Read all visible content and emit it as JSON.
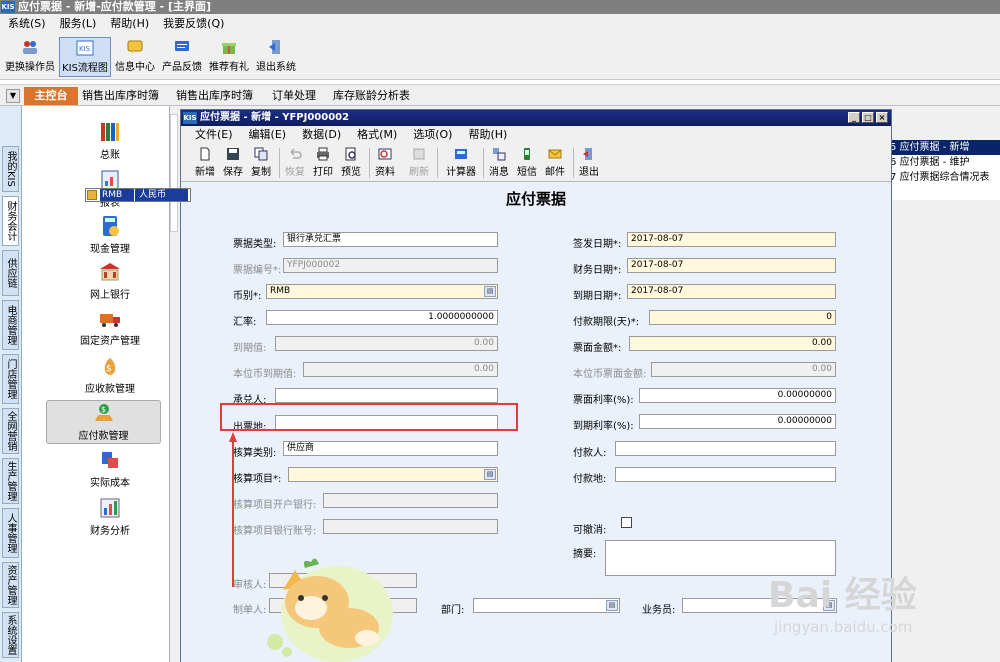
{
  "app": {
    "title": "应付票据 - 新增-应付款管理 - [主界面]",
    "logo": "KIS"
  },
  "menubar": [
    "系统(S)",
    "服务(L)",
    "帮助(H)",
    "我要反馈(Q)"
  ],
  "toolbar": {
    "items": [
      "更换操作员",
      "KIS流程图",
      "信息中心",
      "产品反馈",
      "推荐有礼",
      "退出系统"
    ]
  },
  "tabs": {
    "main": "主控台",
    "items": [
      "销售出库序时簿",
      "销售出库序时簿",
      "订单处理",
      "库存账龄分析表"
    ]
  },
  "leftbar": [
    "我的KIS",
    "财务会计",
    "供应链",
    "电商管理",
    "门店管理",
    "全网营销",
    "生产管理",
    "人事管理",
    "资产管理",
    "系统设置"
  ],
  "nav": [
    "总账",
    "报表",
    "现金管理",
    "网上银行",
    "固定资产管理",
    "应收款管理",
    "应付款管理",
    "实际成本",
    "财务分析"
  ],
  "right_list": [
    {
      "num": "5",
      "label": "应付票据 - 新增"
    },
    {
      "num": "6",
      "label": "应付票据 - 维护"
    },
    {
      "num": "7",
      "label": "应付票据综合情况表"
    }
  ],
  "child": {
    "title": "应付票据 - 新增 - YFPJ000002",
    "logo": "KIS",
    "menu": [
      "文件(E)",
      "编辑(E)",
      "数据(D)",
      "格式(M)",
      "选项(O)",
      "帮助(H)"
    ],
    "tools": [
      "新增",
      "保存",
      "复制",
      "恢复",
      "打印",
      "预览",
      "资料",
      "刷新",
      "计算器",
      "消息",
      "短信",
      "邮件",
      "退出"
    ]
  },
  "form": {
    "title": "应付票据",
    "left": [
      {
        "label": "票据类型:",
        "value": "银行承兑汇票"
      },
      {
        "label": "票据编号*:",
        "value": "YFPJ000002"
      },
      {
        "label": "币别*:",
        "value": "RMB"
      },
      {
        "label": "汇率:",
        "value": "1.0000000000"
      },
      {
        "label": "到期值:",
        "value": "0.00"
      },
      {
        "label": "本位币到期值:",
        "value": "0.00"
      },
      {
        "label": "承兑人:",
        "value": ""
      },
      {
        "label": "出票地:",
        "value": ""
      },
      {
        "label": "核算类别:",
        "value": "供应商"
      },
      {
        "label": "核算项目*:",
        "value": ""
      },
      {
        "label": "核算项目开户银行:",
        "value": ""
      },
      {
        "label": "核算项目银行账号:",
        "value": ""
      }
    ],
    "right": [
      {
        "label": "签发日期*:",
        "value": "2017-08-07"
      },
      {
        "label": "财务日期*:",
        "value": "2017-08-07"
      },
      {
        "label": "到期日期*:",
        "value": "2017-08-07"
      },
      {
        "label": "付款期限(天)*:",
        "value": "0"
      },
      {
        "label": "票面金额*:",
        "value": "0.00"
      },
      {
        "label": "本位币票面金额:",
        "value": "0.00"
      },
      {
        "label": "票面利率(%):",
        "value": "0.00000000"
      },
      {
        "label": "到期利率(%):",
        "value": "0.00000000"
      },
      {
        "label": "付款人:",
        "value": ""
      },
      {
        "label": "付款地:",
        "value": ""
      },
      {
        "label": "可撤消:",
        "value": ""
      },
      {
        "label": "摘要:",
        "value": ""
      }
    ],
    "bottom": [
      {
        "label": "审核人:",
        "value": ""
      },
      {
        "label": "制单人:",
        "value": ""
      },
      {
        "label": "部门:",
        "value": ""
      },
      {
        "label": "业务员:",
        "value": ""
      }
    ],
    "dropdown": {
      "code": "RMB",
      "name": "人民币"
    }
  },
  "watermark": {
    "main": "Bai 经验",
    "url": "jingyan.baidu.com"
  }
}
